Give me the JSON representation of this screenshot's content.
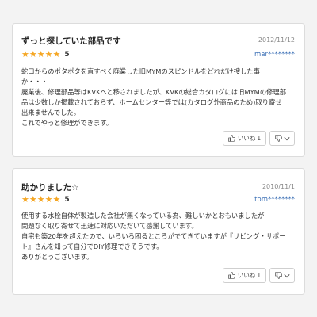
{
  "reviews": [
    {
      "title": "ずっと探していた部品です",
      "date": "2012/11/12",
      "user": "mar********",
      "rating": 5,
      "score_label": "5",
      "body": [
        "蛇口からのポタポタを直すべく廃業した旧MYMのスピンドルをどれだけ捜した事",
        "か・・・",
        "廃業後、修理部品等はKVKへと移されましたが、KVKの総合カタログには旧MYMの修理部",
        "品は少数しか掲載されておらず、ホームセンター等では(カタログ外商品のため)取り寄せ",
        "出来ませんでした。",
        "これでやっと修理ができます。"
      ],
      "like_label": "いいね",
      "like_count": "1"
    },
    {
      "title": "助かりました☆",
      "date": "2010/11/1",
      "user": "tom********",
      "rating": 5,
      "score_label": "5",
      "body": [
        "使用する水栓自体が製造した会社が無くなっている為、難しいかとおもいましたが",
        "問題なく取り寄せて迅速に対応いただいて感謝しています。",
        "自宅も築20年を超えたので、いろいろ困るところがでてきていますが『リビング・サポー",
        "ト』さんを知って自分でDIY修理できそうです。",
        "ありがとうございます。"
      ],
      "like_label": "いいね",
      "like_count": "1"
    }
  ],
  "colors": {
    "star": "#f5a623",
    "user_link": "#3a6fb5",
    "background": "#f3f3f3"
  },
  "icons": {
    "like": "thumbs-up-icon",
    "dislike": "thumbs-down-icon",
    "dropdown": "chevron-down-icon"
  }
}
